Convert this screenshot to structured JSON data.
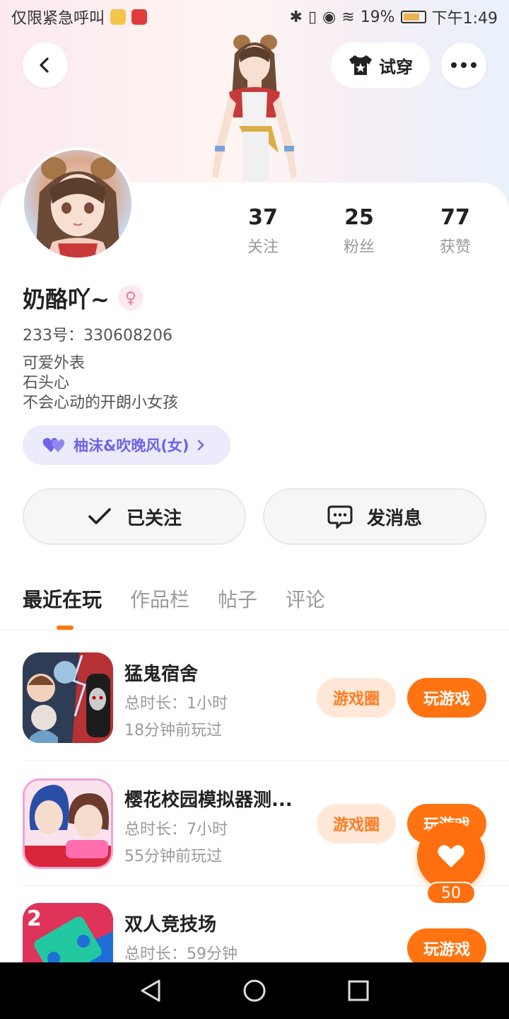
{
  "status_bar": {
    "notification_text": "仅限紧急呼叫",
    "battery": "19%",
    "time": "下午1:49"
  },
  "header": {
    "tryon_label": "试穿"
  },
  "profile": {
    "stats": [
      {
        "value": "37",
        "label": "关注"
      },
      {
        "value": "25",
        "label": "粉丝"
      },
      {
        "value": "77",
        "label": "获赞"
      }
    ],
    "name": "奶酪吖~",
    "gender_symbol": "♀",
    "uid": "233号：330608206",
    "bio": [
      "可爱外表",
      "石头心",
      "不会心动的开朗小女孩"
    ],
    "cp_label": "柚沫&吹晚风(女)"
  },
  "actions": {
    "follow_label": "已关注",
    "message_label": "发消息"
  },
  "tabs": [
    "最近在玩",
    "作品栏",
    "帖子",
    "评论"
  ],
  "games": [
    {
      "title": "猛鬼宿舍",
      "duration": "总时长：1小时",
      "last_played": "18分钟前玩过",
      "circle": "游戏圈",
      "play": "玩游戏"
    },
    {
      "title": "樱花校园模拟器测...",
      "duration": "总时长：7小时",
      "last_played": "55分钟前玩过",
      "circle": "游戏圈",
      "play": "玩游戏"
    },
    {
      "title": "双人竞技场",
      "duration": "总时长：59分钟",
      "last_played": "",
      "circle": "",
      "play": "玩游戏"
    }
  ],
  "fab": {
    "count": "50"
  },
  "colors": {
    "accent": "#ff7311",
    "cp_text": "#6f64e8",
    "gender": "#f07598"
  }
}
